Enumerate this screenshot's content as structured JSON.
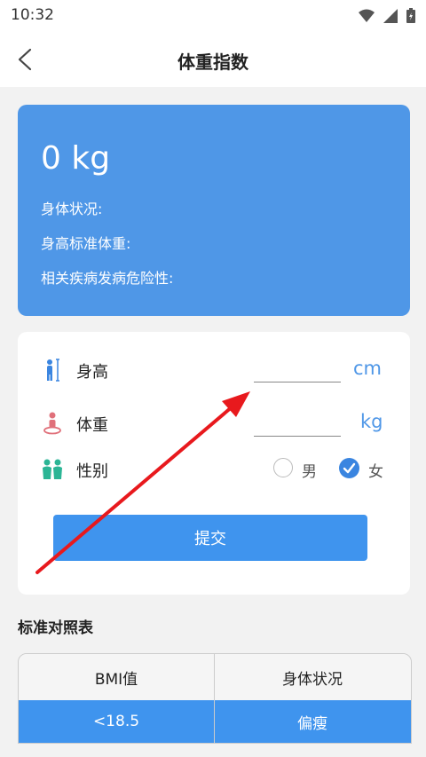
{
  "status_bar": {
    "time": "10:32"
  },
  "header": {
    "title": "体重指数"
  },
  "result": {
    "weight": "0 kg",
    "body_status_label": "身体状况:",
    "standard_weight_label": "身高标准体重:",
    "disease_risk_label": "相关疾病发病危险性:"
  },
  "form": {
    "height_label": "身高",
    "height_unit": "cm",
    "height_value": "",
    "weight_label": "体重",
    "weight_unit": "kg",
    "weight_value": "",
    "gender_label": "性别",
    "gender_male": "男",
    "gender_female": "女",
    "gender_selected": "女",
    "submit_label": "提交"
  },
  "reference": {
    "section_title": "标准对照表",
    "columns": [
      "BMI值",
      "身体状况"
    ],
    "rows": [
      [
        "<18.5",
        "偏瘦"
      ]
    ]
  },
  "colors": {
    "accent": "#4f97e7",
    "button": "#3f94ee",
    "annotation_arrow": "#e8191d"
  }
}
